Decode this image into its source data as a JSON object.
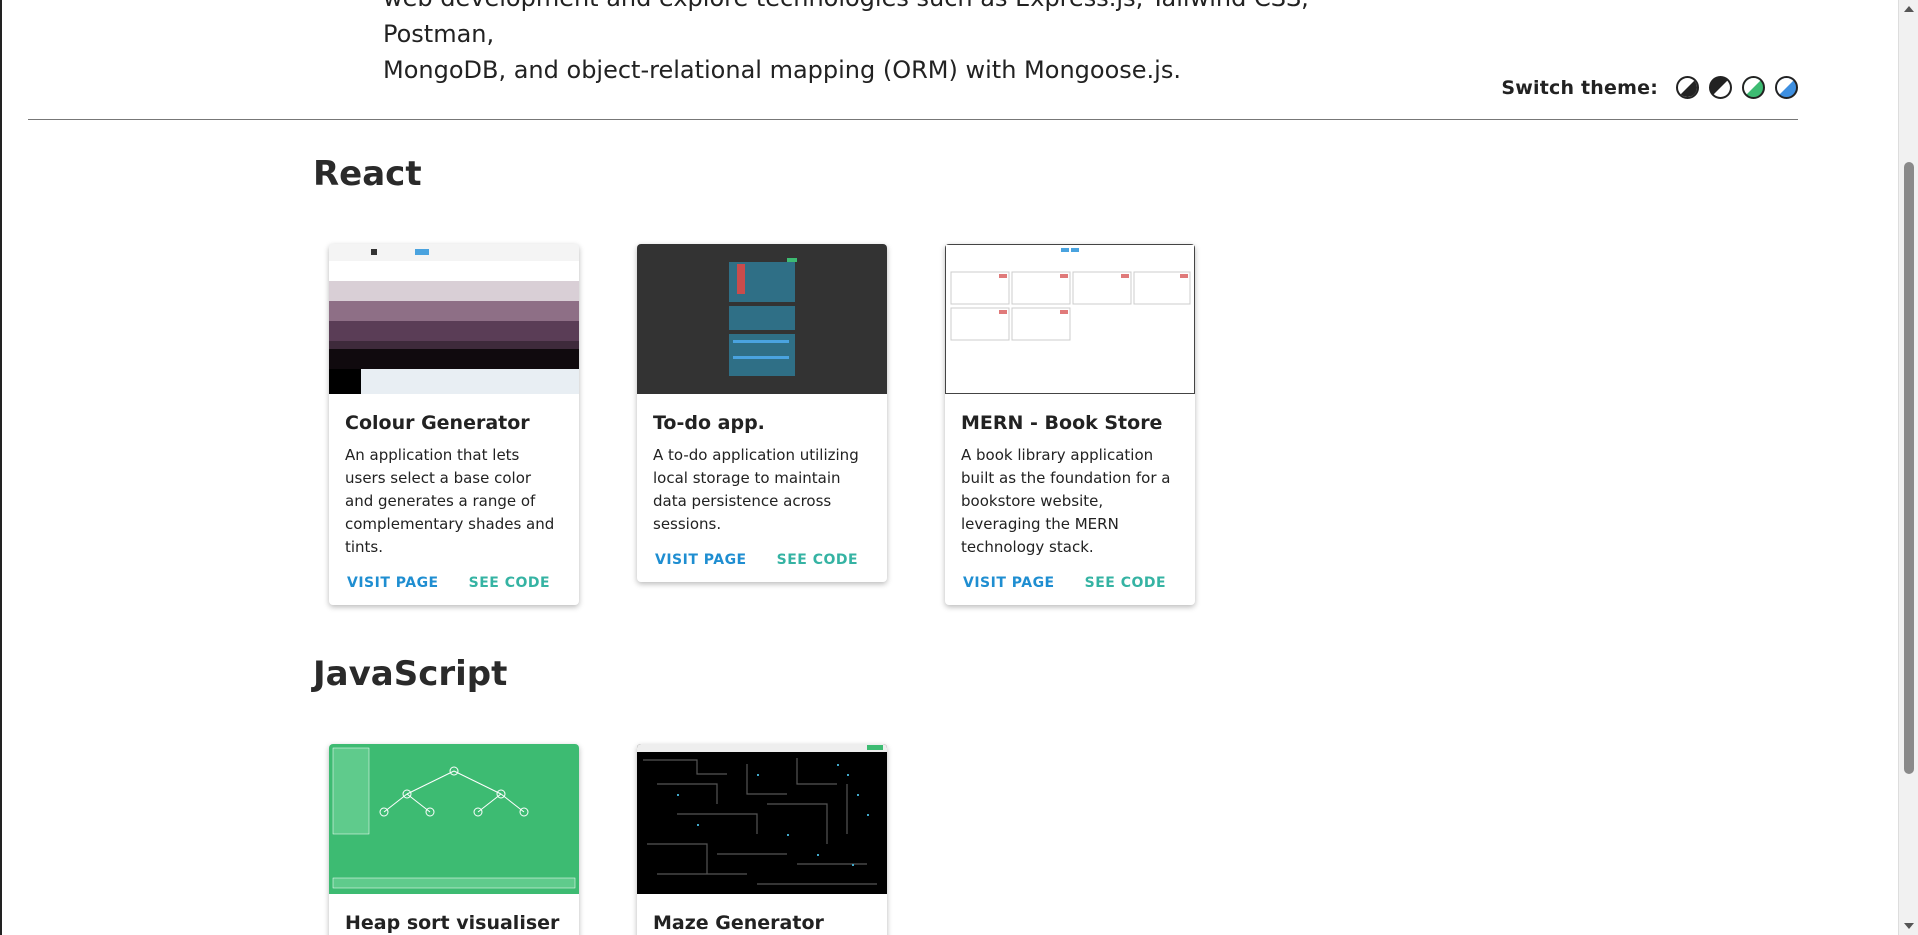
{
  "intro": {
    "line1": "web development and explore technologies such as Express.js, Tailwind CSS, Postman,",
    "line2": "MongoDB, and object-relational mapping (ORM) with Mongoose.js."
  },
  "theme": {
    "label": "Switch theme:",
    "options": [
      {
        "name": "light",
        "color": "#ffffff"
      },
      {
        "name": "dark",
        "color": "#222222"
      },
      {
        "name": "green",
        "color": "#3dbb72"
      },
      {
        "name": "blue",
        "color": "#3e8fe0"
      }
    ]
  },
  "sections": [
    {
      "title": "React",
      "cards": [
        {
          "title": "Colour Generator",
          "description": "An application that lets users select a base color and generates a range of complementary shades and tints.",
          "visit_label": "VISIT PAGE",
          "code_label": "SEE CODE"
        },
        {
          "title": "To-do app.",
          "description": "A to-do application utilizing local storage to maintain data persistence across sessions.",
          "visit_label": "VISIT PAGE",
          "code_label": "SEE CODE"
        },
        {
          "title": "MERN - Book Store",
          "description": "A book library application built as the foundation for a bookstore website, leveraging the MERN technology stack.",
          "visit_label": "VISIT PAGE",
          "code_label": "SEE CODE"
        }
      ]
    },
    {
      "title": "JavaScript",
      "cards": [
        {
          "title": "Heap sort visualiser"
        },
        {
          "title": "Maze Generator"
        }
      ]
    }
  ],
  "colors": {
    "visit": "#1f8ed1",
    "code": "#35b3a3",
    "heap_thumb": "#3dbb72",
    "todo_thumb": "#333333"
  }
}
